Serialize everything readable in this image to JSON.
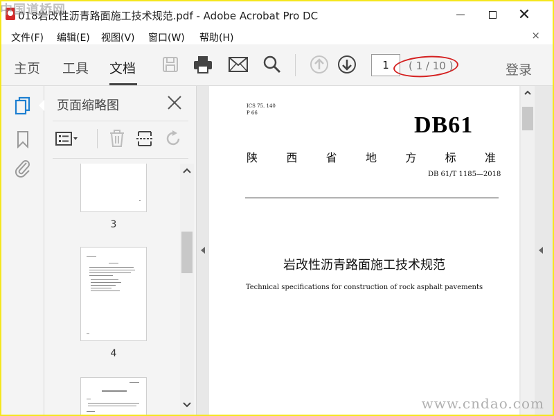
{
  "window": {
    "title": "018岩改性沥青路面施工技术规范.pdf - Adobe Acrobat Pro DC",
    "minimize_label": "",
    "close_label": "✕"
  },
  "watermark": {
    "top": "中国道桥网",
    "bottom": "www.cndao.com"
  },
  "menu": {
    "file": "文件(F)",
    "edit": "编辑(E)",
    "view": "视图(V)",
    "window": "窗口(W)",
    "help": "帮助(H)",
    "close": "×"
  },
  "toolbar": {
    "tabs": {
      "home": "主页",
      "tools": "工具",
      "document": "文档"
    },
    "page_number": "1",
    "page_count": "( 1 / 10 )",
    "login": "登录",
    "accent_color": "#d42020"
  },
  "thumb_panel": {
    "title": "页面缩略图",
    "thumbnails": [
      {
        "label": "3"
      },
      {
        "label": "4"
      }
    ]
  },
  "document": {
    "ics_line1": "ICS  75. 140",
    "ics_line2": "P  66",
    "std_code": "DB61",
    "std_type_chars": [
      "陕",
      "西",
      "省",
      "地",
      "方",
      "标",
      "准"
    ],
    "std_number": "DB 61/T 1185—2018",
    "title_cn": "岩改性沥青路面施工技术规范",
    "title_en": "Technical specifications for construction of rock asphalt pavements"
  }
}
